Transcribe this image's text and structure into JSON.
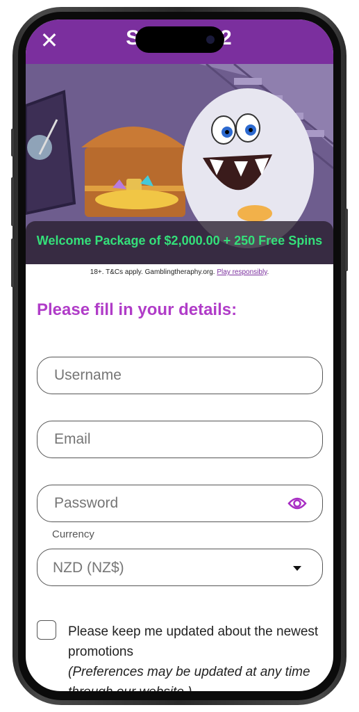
{
  "header": {
    "close_icon": "close-icon",
    "brand_title": "S           2"
  },
  "banner": {
    "promo_text": "Welcome Package of $2,000.00 + 250 Free Spins"
  },
  "disclaimer": {
    "text": "18+. T&Cs apply. Gamblingtheraphy.org.",
    "link": "Play responsibly",
    "suffix": "."
  },
  "form": {
    "title": "Please fill in your details:",
    "username_placeholder": "Username",
    "email_placeholder": "Email",
    "password_placeholder": "Password",
    "currency_label": "Currency",
    "currency_value": "NZD (NZ$)",
    "newsletter_label": "Please keep me updated about the newest promotions",
    "newsletter_note": "(Preferences may be updated at any time through our website.)"
  },
  "colors": {
    "header_bg": "#7b2f9e",
    "title_color": "#b03cc8",
    "promo_color": "#34e07a"
  }
}
